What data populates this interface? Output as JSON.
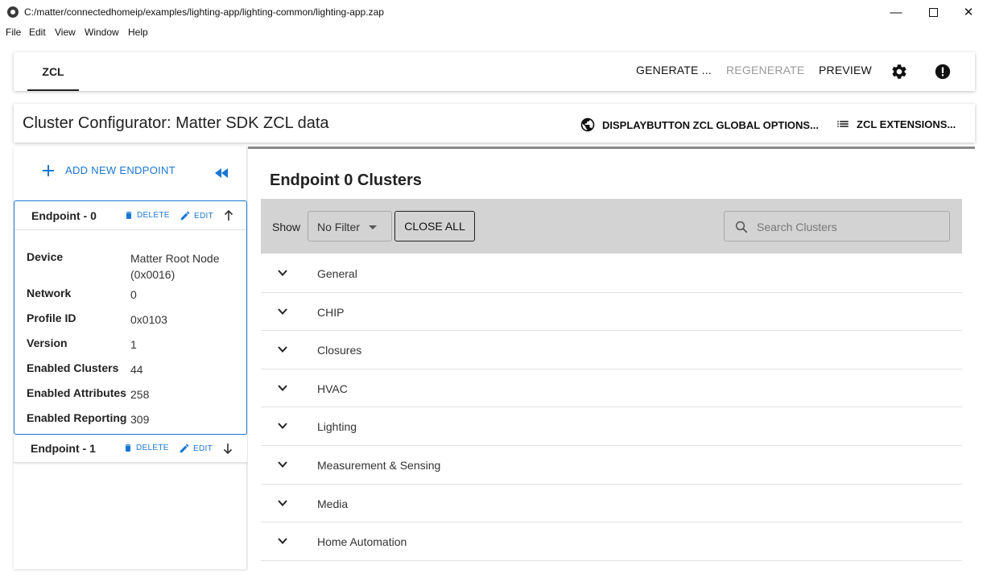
{
  "window": {
    "title": "C:/matter/connectedhomeip/examples/lighting-app/lighting-common/lighting-app.zap",
    "minimize": "—",
    "close": "✕"
  },
  "menu": [
    "File",
    "Edit",
    "View",
    "Window",
    "Help"
  ],
  "toolbar": {
    "tab": "ZCL",
    "generate": "GENERATE ...",
    "regenerate": "REGENERATE",
    "preview": "PREVIEW",
    "icons": [
      "gear-icon",
      "alert-icon"
    ]
  },
  "header": {
    "title": "Cluster Configurator: Matter SDK ZCL data",
    "global_options": "DISPLAYBUTTON ZCL GLOBAL OPTIONS...",
    "extensions": "ZCL EXTENSIONS..."
  },
  "sidebar": {
    "add_endpoint": "ADD NEW ENDPOINT",
    "endpoints": [
      {
        "name": "Endpoint - 0",
        "delete": "DELETE",
        "edit": "EDIT",
        "details": [
          {
            "label": "Device",
            "value": "Matter Root Node (0x0016)"
          },
          {
            "label": "Network",
            "value": "0"
          },
          {
            "label": "Profile ID",
            "value": "0x0103"
          },
          {
            "label": "Version",
            "value": "1"
          },
          {
            "label": "Enabled Clusters",
            "value": "44"
          },
          {
            "label": "Enabled Attributes",
            "value": "258"
          },
          {
            "label": "Enabled Reporting",
            "value": "309"
          }
        ]
      },
      {
        "name": "Endpoint - 1",
        "delete": "DELETE",
        "edit": "EDIT"
      }
    ]
  },
  "main": {
    "title": "Endpoint 0 Clusters",
    "show_label": "Show",
    "filter_value": "No Filter",
    "close_all": "CLOSE ALL",
    "search_placeholder": "Search Clusters",
    "clusters": [
      "General",
      "CHIP",
      "Closures",
      "HVAC",
      "Lighting",
      "Measurement & Sensing",
      "Media",
      "Home Automation"
    ]
  },
  "colors": {
    "accent": "#1976d2",
    "filter_bar": "#d3d3d3",
    "disabled": "#9a9a9a"
  }
}
